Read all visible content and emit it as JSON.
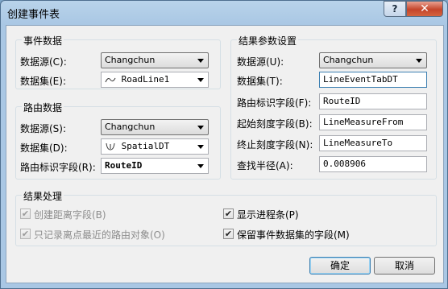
{
  "window": {
    "title": "创建事件表",
    "help_label": "?",
    "close_label": "✕"
  },
  "event_data": {
    "group_title": "事件数据",
    "source_label": "数据源(C):",
    "source_value": "Changchun",
    "dataset_label": "数据集(E):",
    "dataset_value": "RoadLine1",
    "dataset_icon": "line-dataset-icon"
  },
  "route_data": {
    "group_title": "路由数据",
    "source_label": "数据源(S):",
    "source_value": "Changchun",
    "dataset_label": "数据集(D):",
    "dataset_value": "SpatialDT",
    "dataset_icon": "route-dataset-icon",
    "field_label": "路由标识字段(R):",
    "field_value": "RouteID"
  },
  "result_params": {
    "group_title": "结果参数设置",
    "source_label": "数据源(U):",
    "source_value": "Changchun",
    "dataset_label": "数据集(T):",
    "dataset_value": "LineEventTabDT",
    "route_field_label": "路由标识字段(F):",
    "route_field_value": "RouteID",
    "from_field_label": "起始刻度字段(B):",
    "from_field_value": "LineMeasureFrom",
    "to_field_label": "终止刻度字段(N):",
    "to_field_value": "LineMeasureTo",
    "radius_label": "查找半径(A):",
    "radius_value": "0.008906"
  },
  "result_processing": {
    "group_title": "结果处理",
    "create_distance_field": {
      "label": "创建距离字段(B)",
      "checked": true,
      "disabled": true
    },
    "show_progress": {
      "label": "显示进程条(P)",
      "checked": true,
      "disabled": false
    },
    "nearest_route_only": {
      "label": "只记录离点最近的路由对象(O)",
      "checked": true,
      "disabled": true
    },
    "keep_event_fields": {
      "label": "保留事件数据集的字段(M)",
      "checked": true,
      "disabled": false
    }
  },
  "buttons": {
    "ok_label": "确定",
    "cancel_label": "取消"
  },
  "colors": {
    "title_bar": "#a9c7e4",
    "client_bg": "#f0f0f0",
    "close_button": "#c4452b",
    "focus_border": "#3c7fb1"
  }
}
